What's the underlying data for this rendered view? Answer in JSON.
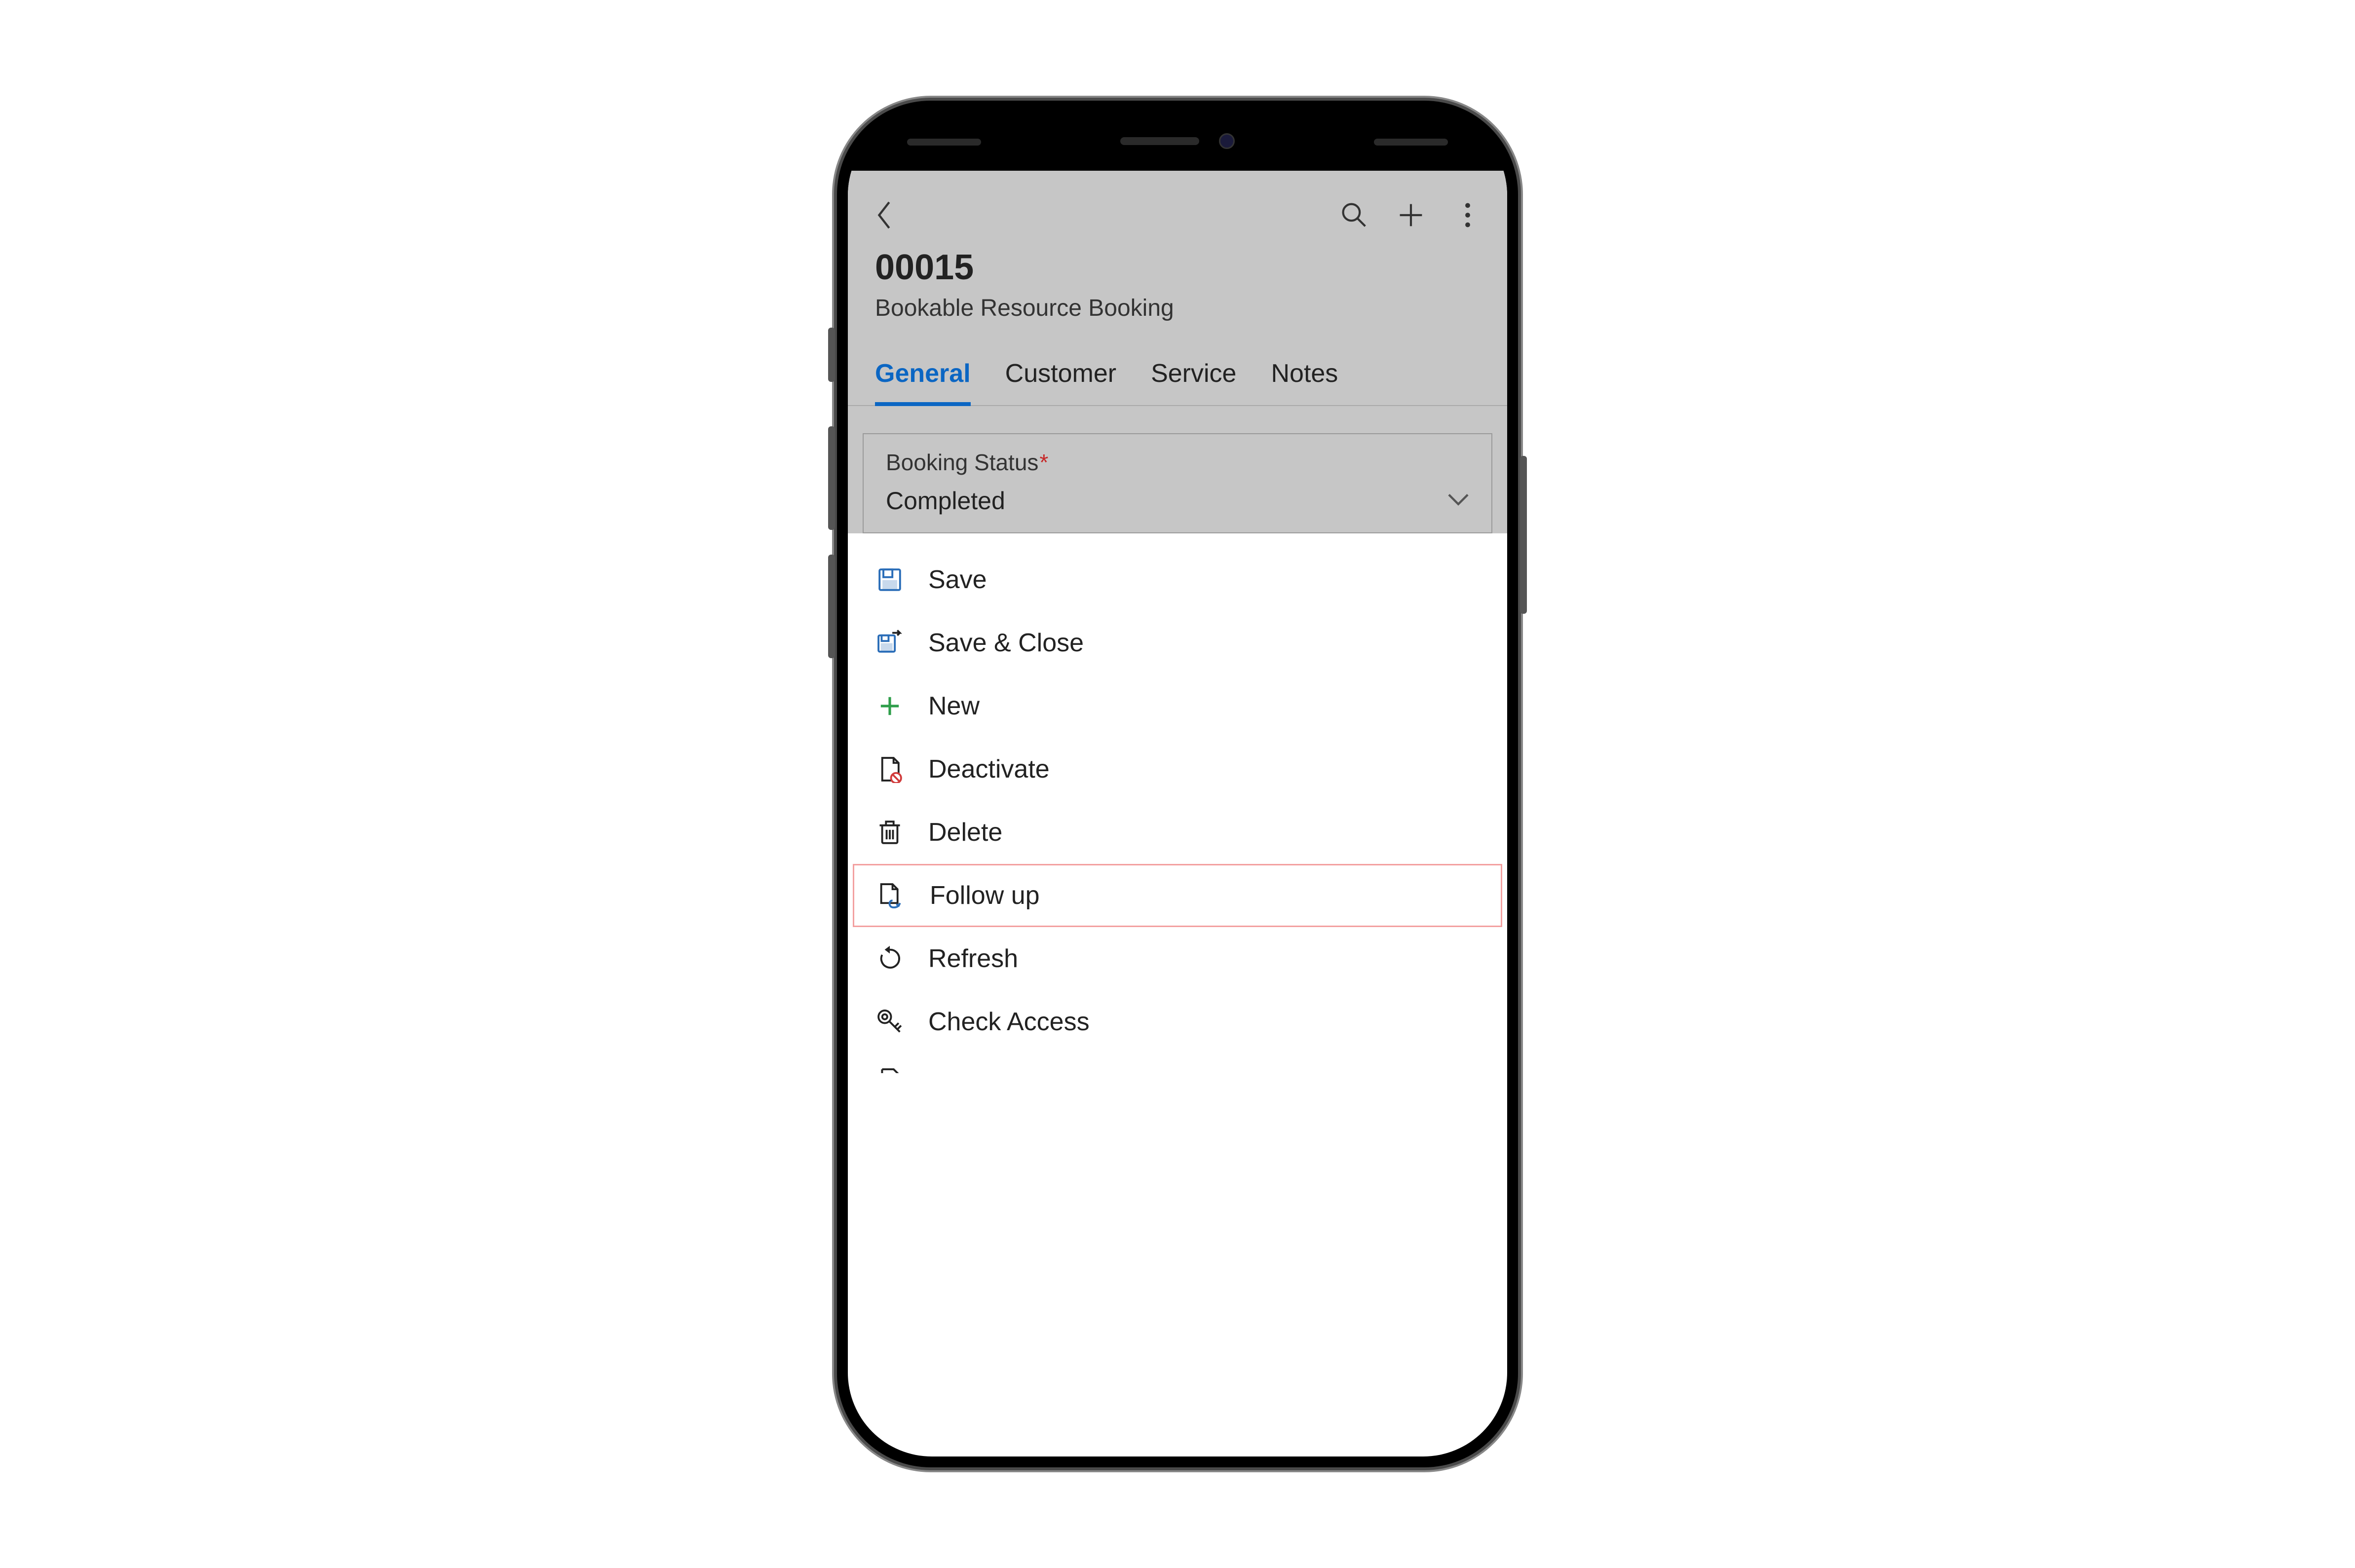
{
  "header": {
    "title": "00015",
    "subtitle": "Bookable Resource Booking"
  },
  "tabs": [
    {
      "label": "General",
      "active": true
    },
    {
      "label": "Customer",
      "active": false
    },
    {
      "label": "Service",
      "active": false
    },
    {
      "label": "Notes",
      "active": false
    }
  ],
  "field": {
    "label": "Booking Status",
    "required_mark": "*",
    "value": "Completed"
  },
  "menu": {
    "save": "Save",
    "save_close": "Save & Close",
    "new": "New",
    "deactivate": "Deactivate",
    "delete": "Delete",
    "follow_up": "Follow up",
    "refresh": "Refresh",
    "check_access": "Check Access"
  }
}
